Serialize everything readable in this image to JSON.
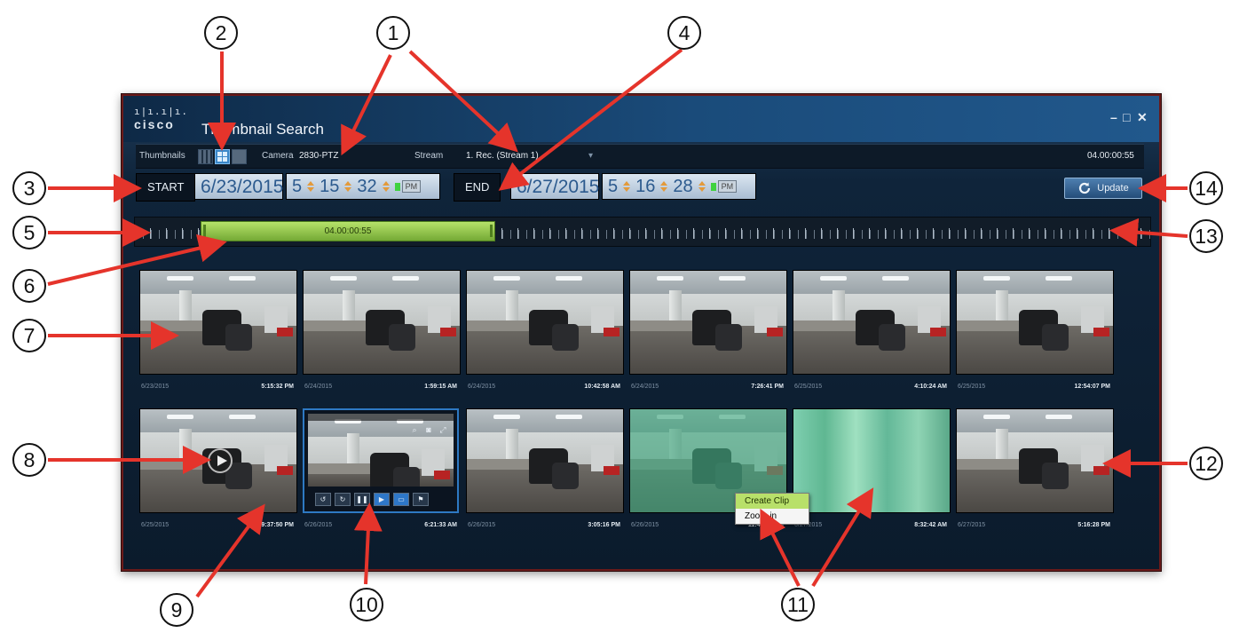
{
  "window": {
    "brand": "cisco",
    "title": "Thumbnail Search",
    "controls": {
      "minimize": "–",
      "maximize": "□",
      "close": "✕"
    }
  },
  "toolbar": {
    "thumbnails_label": "Thumbnails",
    "camera_label": "Camera",
    "camera_value": "2830-PTZ",
    "stream_label": "Stream",
    "stream_value": "1. Rec. (Stream 1)",
    "duration": "04.00:00:55"
  },
  "range": {
    "start_label": "START",
    "start_date": "6/23/2015",
    "start_time": {
      "h": "5",
      "m": "15",
      "s": "32",
      "ampm": "PM"
    },
    "end_label": "END",
    "end_date": "6/27/2015",
    "end_time": {
      "h": "5",
      "m": "16",
      "s": "28",
      "ampm": "PM"
    },
    "update_label": "Update"
  },
  "timeline": {
    "selection_label": "04.00:00:55"
  },
  "thumbnails": [
    {
      "date": "6/23/2015",
      "time": "5:15:32 PM"
    },
    {
      "date": "6/24/2015",
      "time": "1:59:15 AM"
    },
    {
      "date": "6/24/2015",
      "time": "10:42:58 AM"
    },
    {
      "date": "6/24/2015",
      "time": "7:26:41 PM"
    },
    {
      "date": "6/25/2015",
      "time": "4:10:24 AM"
    },
    {
      "date": "6/25/2015",
      "time": "12:54:07 PM"
    },
    {
      "date": "6/25/2015",
      "time": "9:37:50 PM"
    },
    {
      "date": "6/26/2015",
      "time": "6:21:33 AM"
    },
    {
      "date": "6/26/2015",
      "time": "3:05:16 PM"
    },
    {
      "date": "6/26/2015",
      "time": "11:48:59 PM"
    },
    {
      "date": "6/27/2015",
      "time": "8:32:42 AM"
    },
    {
      "date": "6/27/2015",
      "time": "5:16:28 PM"
    }
  ],
  "context_menu": [
    "Create Clip",
    "Zoom in"
  ],
  "callouts": [
    "1",
    "2",
    "3",
    "4",
    "5",
    "6",
    "7",
    "8",
    "9",
    "10",
    "11",
    "12",
    "13",
    "14"
  ],
  "colors": {
    "annotation_arrow": "#e5342b",
    "selection": "#8fc44a",
    "window_border": "#6a1a1a"
  }
}
